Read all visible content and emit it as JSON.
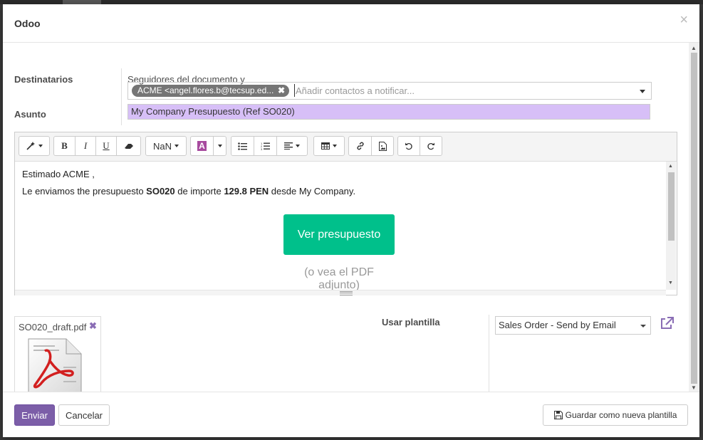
{
  "dialog": {
    "title": "Odoo",
    "close_glyph": "×"
  },
  "form": {
    "recipients_label": "Destinatarios",
    "followers_text": "Seguidores del documento y",
    "recipient_tag": "ACME <angel.flores.b@tecsup.ed...",
    "recipients_placeholder": "Añadir contactos a notificar...",
    "subject_label": "Asunto",
    "subject_value": "My Company Presupuesto (Ref SO020)"
  },
  "editor": {
    "toolbar": {
      "style_icon": "magic-wand-icon",
      "bold": "B",
      "italic": "I",
      "underline": "U",
      "eraser_icon": "eraser-icon",
      "font_size": "NaN",
      "color_glyph": "A",
      "list_ul_icon": "list-ul-icon",
      "list_ol_icon": "list-ol-icon",
      "align_icon": "align-left-icon",
      "table_icon": "table-icon",
      "link_icon": "link-icon",
      "image_icon": "image-icon",
      "undo_icon": "undo-icon",
      "redo_icon": "redo-icon"
    },
    "greeting": "Estimado ACME ,",
    "body_pre": "Le enviamos the presupuesto ",
    "body_ref": "SO020",
    "body_mid": " de importe ",
    "body_amount": "129.8 PEN",
    "body_post": " desde My Company.",
    "cta_label": "Ver presupuesto",
    "pdf_note": "(o vea el PDF adjunto)"
  },
  "attachment": {
    "filename": "SO020_draft.pdf",
    "remove_glyph": "✖"
  },
  "template": {
    "label": "Usar plantilla",
    "selected": "Sales Order - Send by Email"
  },
  "footer": {
    "send_label": "Enviar",
    "cancel_label": "Cancelar",
    "save_template_label": "Guardar como nueva plantilla"
  },
  "colors": {
    "primary": "#7c5ea8",
    "cta": "#00c08b",
    "subject_bg": "#d7bff7",
    "tag_bg": "#757575"
  }
}
